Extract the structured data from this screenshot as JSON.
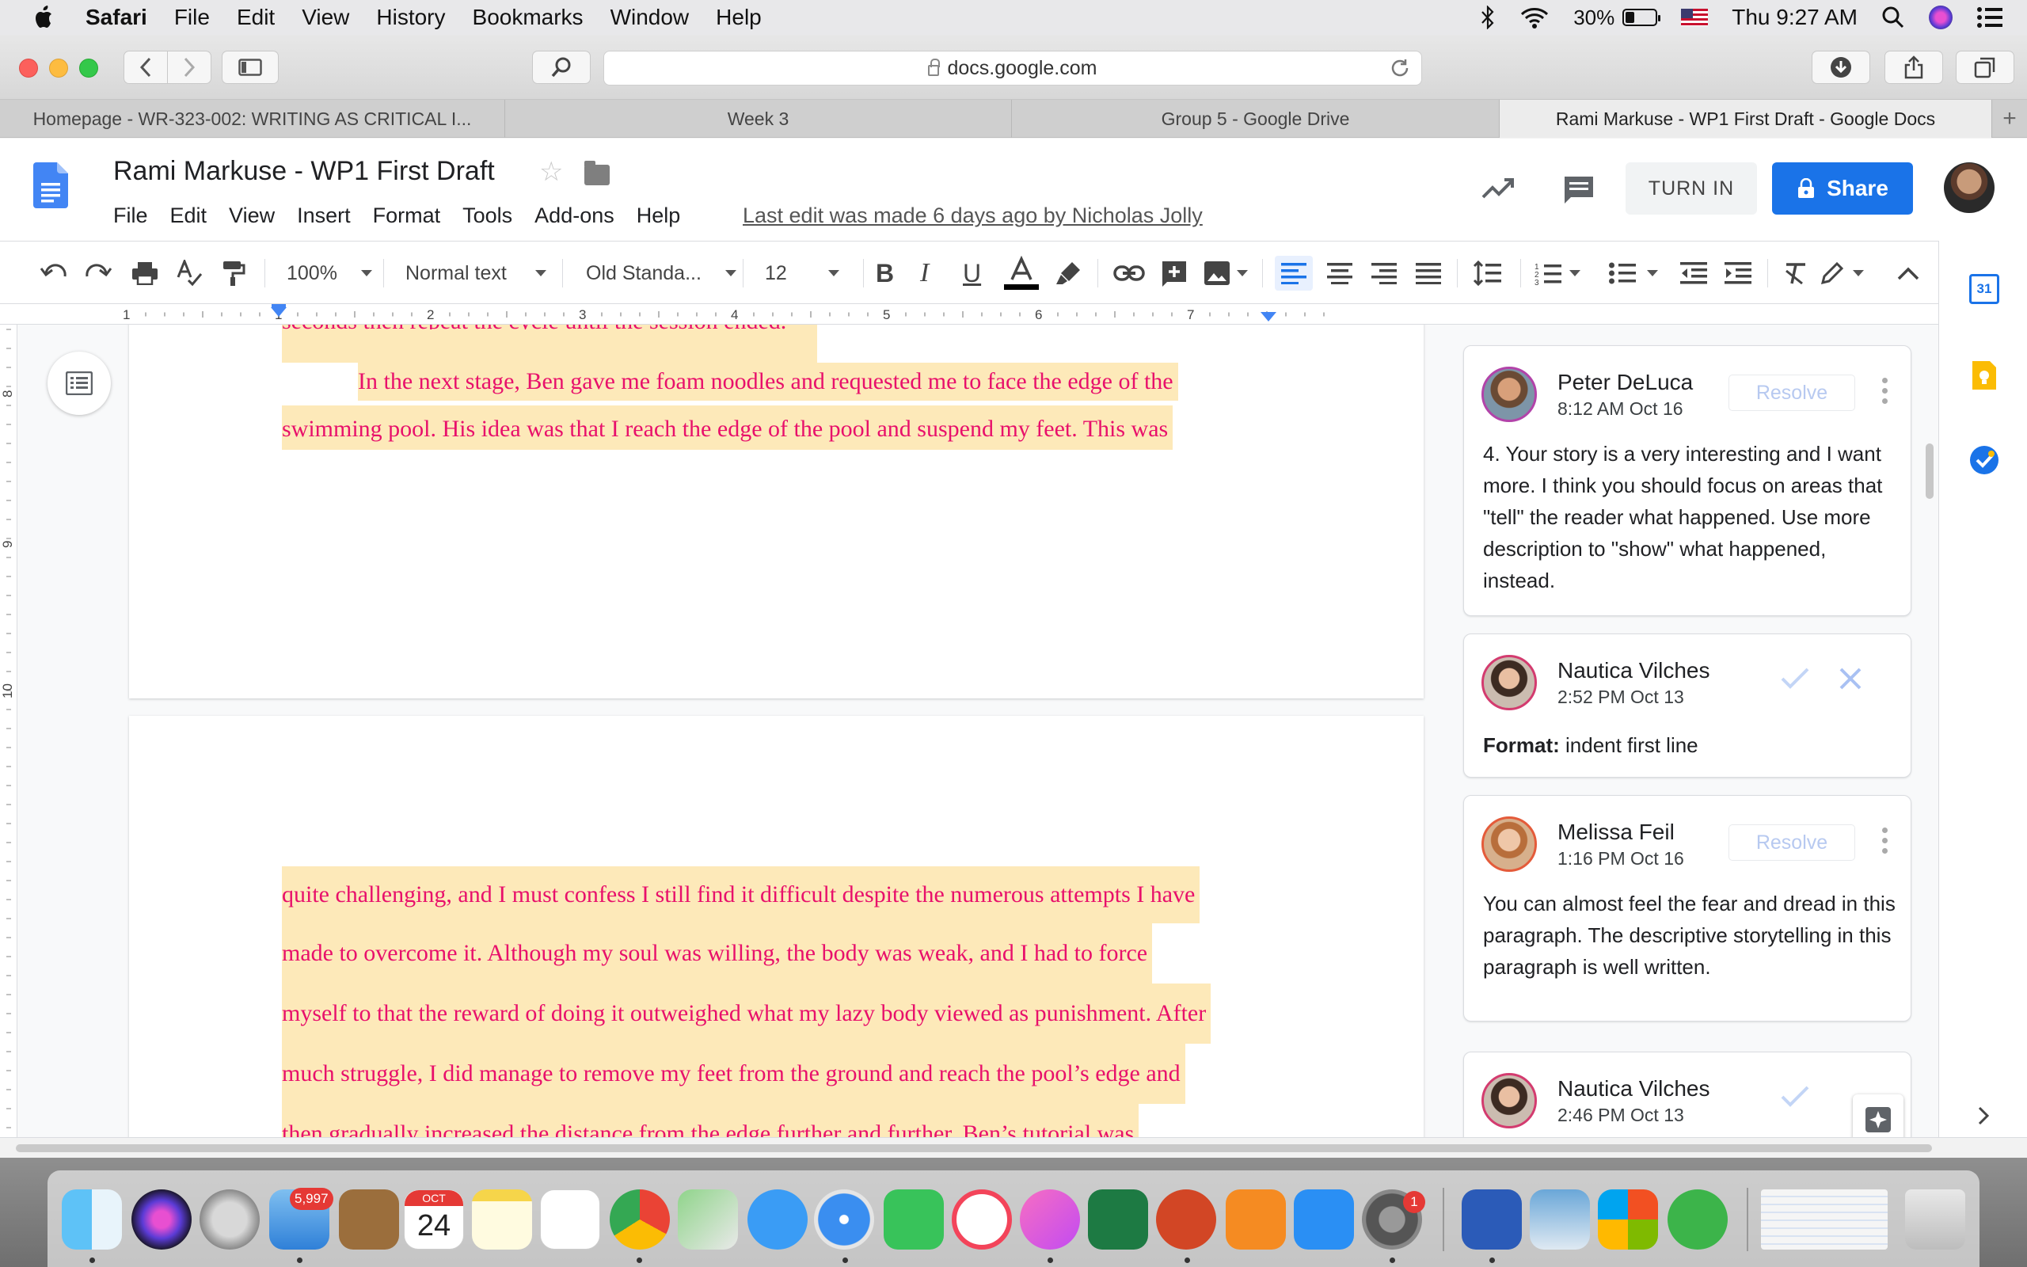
{
  "menubar": {
    "app": "Safari",
    "items": [
      "File",
      "Edit",
      "View",
      "History",
      "Bookmarks",
      "Window",
      "Help"
    ],
    "battery": "30%",
    "battery_level": 0.3,
    "clock": "Thu 9:27 AM"
  },
  "browser": {
    "url": "docs.google.com",
    "tabs": [
      "Homepage - WR-323-002: WRITING AS CRITICAL I...",
      "Week 3",
      "Group 5 - Google Drive",
      "Rami Markuse - WP1 First Draft - Google Docs"
    ],
    "new_tab": "+"
  },
  "doc": {
    "title": "Rami Markuse - WP1 First Draft",
    "menu": [
      "File",
      "Edit",
      "View",
      "Insert",
      "Format",
      "Tools",
      "Add-ons",
      "Help"
    ],
    "last_edit": "Last edit was made 6 days ago by Nicholas Jolly",
    "turn_in": "TURN IN",
    "share": "Share"
  },
  "toolbar": {
    "zoom": "100%",
    "style": "Normal text",
    "font": "Old Standa...",
    "size": "12"
  },
  "ruler": {
    "h_numbers": [
      "1",
      "1",
      "2",
      "3",
      "4",
      "5",
      "6",
      "7"
    ],
    "v_numbers": [
      "8",
      "9",
      "10"
    ]
  },
  "page1": {
    "lines": [
      "seconds then repeat the cycle until the session ended.",
      "In the next stage, Ben gave me foam noodles and requested me to face the edge of the",
      "swimming pool. His idea was that I reach the edge of the pool and suspend my feet. This was"
    ]
  },
  "page2": {
    "lines": [
      "quite challenging, and I must confess I still find it difficult despite the numerous attempts I have",
      "made to overcome it. Although my soul was willing, the body was weak, and I had to force",
      "myself to that the reward of doing it outweighed what my lazy body viewed as punishment. After",
      "much struggle, I did manage to remove my feet from the ground and reach the pool’s edge and",
      "then gradually increased the distance from the edge further and further. Ben’s tutorial was"
    ]
  },
  "comments": [
    {
      "name": "Peter DeLuca",
      "time": "8:12 AM Oct 16",
      "action": "Resolve",
      "text": "4. Your story is a very interesting and I want more. I think you should focus on areas that \"tell\" the reader what happened. Use more description to \"show\" what happened, instead."
    },
    {
      "name": "Nautica Vilches",
      "time": "2:52 PM Oct 13",
      "format_label": "Format:",
      "format_value": " indent first line"
    },
    {
      "name": "Melissa Feil",
      "time": "1:16 PM Oct 16",
      "action": "Resolve",
      "text": "You can almost feel the fear and dread in this paragraph. The descriptive storytelling in this paragraph is well written."
    },
    {
      "name": "Nautica Vilches",
      "time": "2:46 PM Oct 13"
    }
  ],
  "sidepanel": {
    "calendar_day": "31"
  },
  "dock": {
    "mail_badge": "5,997",
    "calendar_month": "OCT",
    "calendar_day": "24",
    "settings_badge": "1"
  },
  "colors": {
    "accent": "#1a73e8",
    "highlight": "#fde9b9",
    "doc_text": "#e8106b"
  }
}
